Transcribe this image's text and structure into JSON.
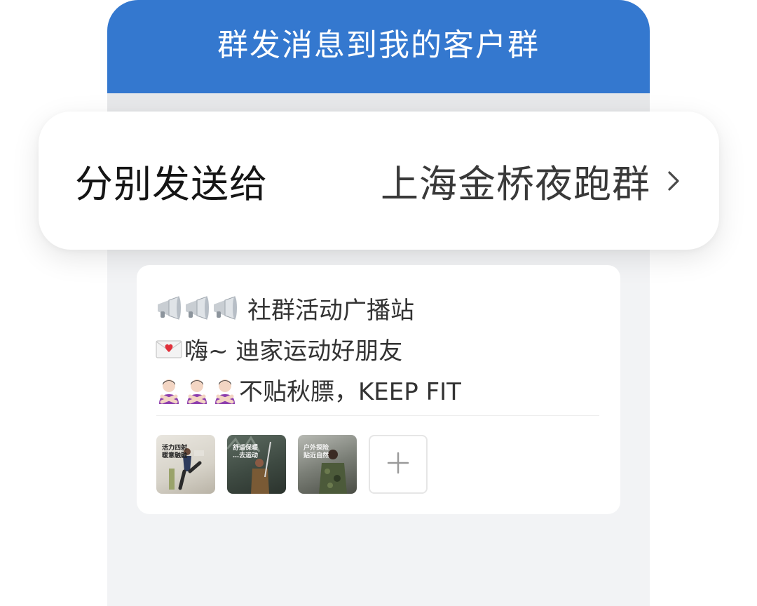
{
  "header": {
    "title": "群发消息到我的客户群"
  },
  "recipient": {
    "label": "分别发送给",
    "value": "上海金桥夜跑群",
    "chevron_icon": "chevron-right-icon"
  },
  "message": {
    "lines": [
      {
        "emoji_icon": "megaphone-icon",
        "emoji_count": 3,
        "text": "社群活动广播站"
      },
      {
        "emoji_icon": "love-letter-icon",
        "emoji_count": 1,
        "text": "嗨~ 迪家运动好朋友"
      },
      {
        "emoji_icon": "no-gesture-woman-icon",
        "emoji_count": 3,
        "text": "不贴秋膘，KEEP FIT"
      }
    ]
  },
  "attachments": {
    "images": [
      {
        "caption_line1": "活力四射",
        "caption_line2": "暖意融融"
      },
      {
        "caption_line1": "舒适保暖",
        "caption_line2": "…去运动"
      },
      {
        "caption_line1": "户外探险",
        "caption_line2": "贴近自然"
      }
    ],
    "add_icon": "plus-icon"
  },
  "colors": {
    "header_blue": "#3478cf",
    "page_bg": "#f2f3f5",
    "card_bg": "#ffffff",
    "text_dark": "#151515",
    "text_body": "#333333"
  }
}
